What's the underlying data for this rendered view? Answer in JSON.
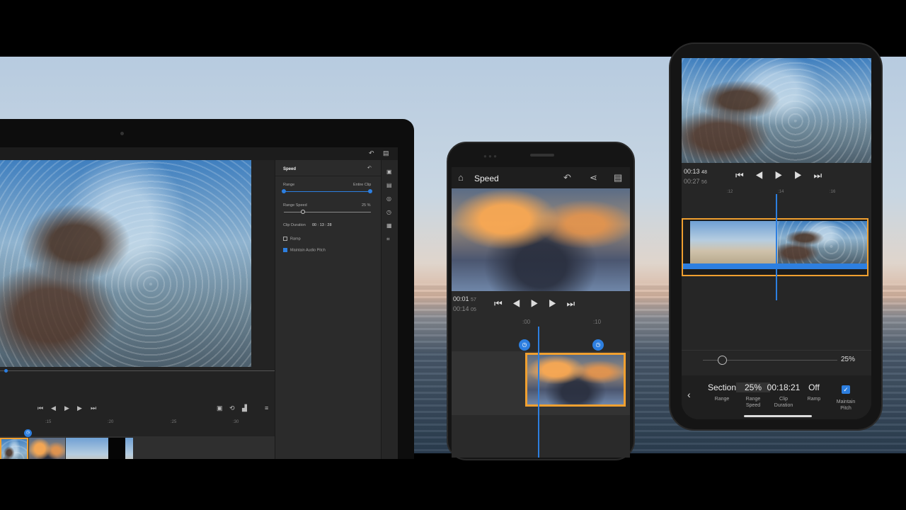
{
  "laptop": {
    "panel": {
      "title": "Speed",
      "range_label": "Range",
      "range_value": "Entire Clip",
      "range_speed_label": "Range Speed",
      "range_speed_value": "25 %",
      "clip_duration_label": "Clip Duration",
      "clip_duration_value": "00 : 13 : 28",
      "ramp_label": "Ramp",
      "maintain_pitch_label": "Maintain Audio Pitch"
    },
    "ruler": [
      ":15",
      ":20",
      ":25",
      ":30"
    ]
  },
  "phone1": {
    "title": "Speed",
    "current_time": "00:01",
    "current_frames": "57",
    "total_time": "00:14",
    "total_frames": "05",
    "ruler": [
      ":00",
      ":10"
    ]
  },
  "phone2": {
    "current_time": "00:13",
    "current_frames": "48",
    "total_time": "00:27",
    "total_frames": "56",
    "ruler": [
      ":12",
      ":14",
      ":16"
    ],
    "slider_value": "25%",
    "options": [
      {
        "value": "Section",
        "label": "Range"
      },
      {
        "value": "25%",
        "label": "Range Speed"
      },
      {
        "value": "00:18:21",
        "label": "Clip Duration"
      },
      {
        "value": "Off",
        "label": "Ramp"
      },
      {
        "value": "",
        "label": "Maintain Pitch"
      }
    ]
  },
  "colors": {
    "accent": "#2d7fe0",
    "clip_border": "#f0a030"
  },
  "icons": [
    "home-icon",
    "undo-icon",
    "share-icon",
    "comment-icon",
    "skip-back-icon",
    "step-back-icon",
    "play-icon",
    "step-forward-icon",
    "skip-forward-icon",
    "back-chevron-icon",
    "checkbox-checked-icon"
  ]
}
